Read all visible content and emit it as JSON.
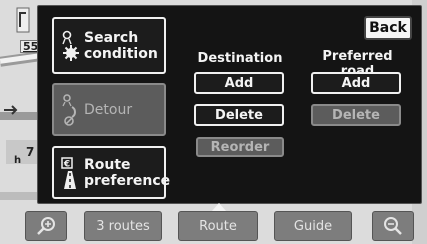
{
  "map": {
    "labels": [
      "55",
      "7",
      "h"
    ]
  },
  "menu": {
    "back_label": "Back",
    "search_condition": {
      "line1": "Search",
      "line2": "condition",
      "icon": "gear-settings-icon"
    },
    "detour": {
      "label": "Detour",
      "icon": "detour-route-icon",
      "enabled": false
    },
    "route_preference": {
      "line1": "Route",
      "line2": "preference",
      "icon": "route-road-icon"
    },
    "destination": {
      "heading": "Destination",
      "add_label": "Add",
      "delete_label": "Delete",
      "reorder_label": "Reorder",
      "reorder_enabled": false
    },
    "preferred_road": {
      "heading": "Preferred road",
      "add_label": "Add",
      "delete_label": "Delete",
      "delete_enabled": false
    }
  },
  "bottom_bar": {
    "zoom_in_icon": "zoom-in-icon",
    "routes_label": "3 routes",
    "route_label": "Route",
    "guide_label": "Guide",
    "zoom_out_icon": "zoom-out-icon"
  }
}
